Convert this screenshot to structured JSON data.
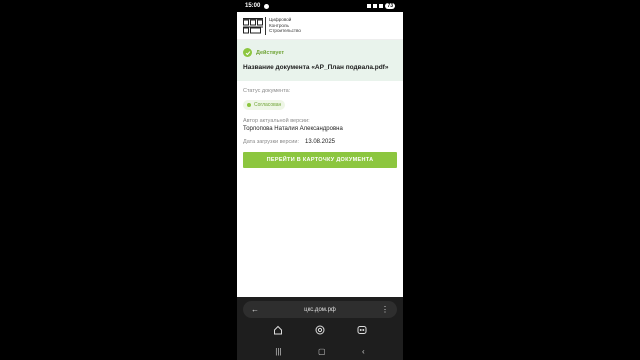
{
  "status_bar": {
    "time": "15:00",
    "battery": "73"
  },
  "brand": {
    "line1": "Цифровой",
    "line2": "Контроль",
    "line3": "Строительство"
  },
  "active": {
    "label": "Действует",
    "doc_title": "Название документа «АР_План подвала.pdf»"
  },
  "document": {
    "status_label": "Статус документа:",
    "status_value": "Согласован",
    "author_label": "Автор актуальной версии:",
    "author_value": "Торлопова Наталия Александровна",
    "date_label": "Дата загрузки версии:",
    "date_value": "13.08.2025",
    "open_button": "ПЕРЕЙТИ В КАРТОЧКУ ДОКУМЕНТА"
  },
  "browser": {
    "url": "цкс.дом.рф"
  },
  "colors": {
    "accent": "#8cc63f",
    "panel_bg": "#e9f3ec"
  },
  "icons": [
    "check-icon",
    "back-arrow-icon",
    "menu-icon",
    "home-icon",
    "browser-icon",
    "tabs-icon"
  ]
}
